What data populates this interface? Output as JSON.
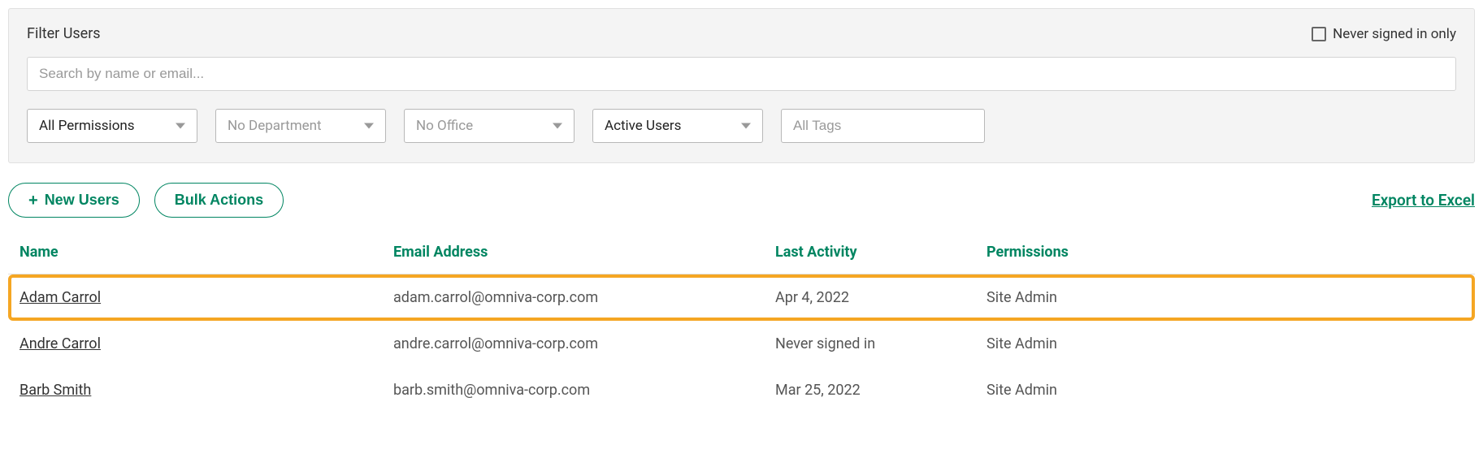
{
  "filter": {
    "title": "Filter Users",
    "never_signed_in_label": "Never signed in only",
    "search_placeholder": "Search by name or email...",
    "selects": {
      "permissions": "All Permissions",
      "department": "No Department",
      "office": "No Office",
      "status": "Active Users"
    },
    "tags_placeholder": "All Tags"
  },
  "actions": {
    "new_users": "New Users",
    "bulk_actions": "Bulk Actions",
    "export": "Export to Excel"
  },
  "table": {
    "headers": {
      "name": "Name",
      "email": "Email Address",
      "activity": "Last Activity",
      "permissions": "Permissions"
    },
    "rows": [
      {
        "name": "Adam Carrol",
        "email": "adam.carrol@omniva-corp.com",
        "activity": "Apr 4, 2022",
        "permissions": "Site Admin",
        "highlighted": true
      },
      {
        "name": "Andre Carrol",
        "email": "andre.carrol@omniva-corp.com",
        "activity": "Never signed in",
        "permissions": "Site Admin",
        "highlighted": false
      },
      {
        "name": "Barb Smith",
        "email": "barb.smith@omniva-corp.com",
        "activity": "Mar 25, 2022",
        "permissions": "Site Admin",
        "highlighted": false
      }
    ]
  }
}
